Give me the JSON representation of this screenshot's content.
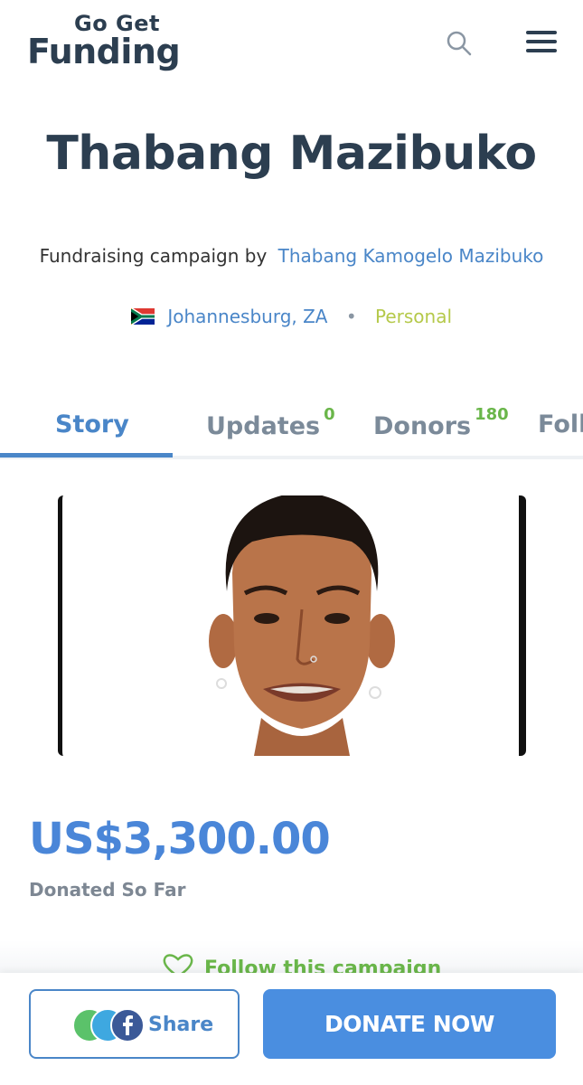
{
  "header": {
    "logo_line1": "Go Get",
    "logo_line2": "Funding",
    "search_icon": "search-icon",
    "menu_icon": "hamburger-menu-icon"
  },
  "campaign": {
    "title": "Thabang Mazibuko",
    "byline_prefix": "Fundraising campaign by",
    "organizer": "Thabang Kamogelo Mazibuko",
    "location": "Johannesburg, ZA",
    "separator": "•",
    "category": "Personal"
  },
  "tabs": [
    {
      "label": "Story",
      "count": ""
    },
    {
      "label": "Updates",
      "count": "0"
    },
    {
      "label": "Donors",
      "count": "180"
    },
    {
      "label": "Followers",
      "count": ""
    }
  ],
  "funding": {
    "amount": "US$3,300.00",
    "label": "Donated So Far",
    "follow_label": "Follow this campaign"
  },
  "actions": {
    "share_label": "Share",
    "donate_label": "DONATE NOW"
  },
  "colors": {
    "primary_blue": "#4a86c8",
    "donate_blue": "#4a8ee0",
    "green_accent": "#6ab64a",
    "category_green": "#b5c94a",
    "dark_text": "#2c3e50"
  }
}
